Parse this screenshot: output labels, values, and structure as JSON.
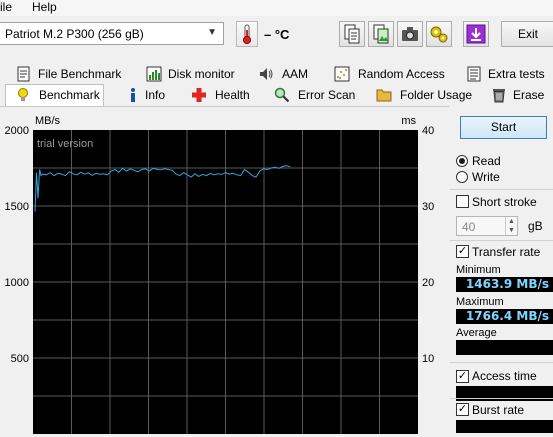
{
  "menu": [
    "ile",
    "Help"
  ],
  "toolbar": {
    "drive": "Patriot M.2 P300 (256 gB)",
    "temperature": "– °C",
    "exit_label": "Exit"
  },
  "tabs_row1": [
    {
      "label": "File Benchmark",
      "icon": "file-benchmark-icon"
    },
    {
      "label": "Disk monitor",
      "icon": "disk-monitor-icon"
    },
    {
      "label": "AAM",
      "icon": "speaker-icon"
    },
    {
      "label": "Random Access",
      "icon": "random-access-icon"
    },
    {
      "label": "Extra tests",
      "icon": "extra-tests-icon"
    }
  ],
  "tabs_row2": [
    {
      "label": "Benchmark",
      "icon": "lightbulb-icon",
      "active": true
    },
    {
      "label": "Info",
      "icon": "info-icon"
    },
    {
      "label": "Health",
      "icon": "health-cross-icon"
    },
    {
      "label": "Error Scan",
      "icon": "magnifier-icon"
    },
    {
      "label": "Folder Usage",
      "icon": "folder-icon"
    },
    {
      "label": "Erase",
      "icon": "trash-icon"
    }
  ],
  "panel": {
    "start_label": "Start",
    "read_label": "Read",
    "write_label": "Write",
    "mode": "read",
    "short_stroke_label": "Short stroke",
    "short_stroke_checked": false,
    "stroke_value": "40",
    "stroke_unit": "gB",
    "transfer_rate_label": "Transfer rate",
    "transfer_rate_checked": true,
    "minimum_label": "Minimum",
    "minimum_value": "1463.9 MB/s",
    "maximum_label": "Maximum",
    "maximum_value": "1766.4 MB/s",
    "average_label": "Average",
    "average_value": "",
    "access_time_label": "Access time",
    "access_time_checked": true,
    "burst_rate_label": "Burst rate",
    "burst_rate_checked": true,
    "burst_rate_value": ""
  },
  "chart_data": {
    "type": "line",
    "watermark": "trial version",
    "ylabel": "MB/s",
    "y2label": "ms",
    "ylim": [
      0,
      2000
    ],
    "y2lim": [
      0,
      40
    ],
    "yticks": [
      "2000",
      "1500",
      "1000",
      "500"
    ],
    "y2ticks": [
      "40",
      "30",
      "20",
      "10"
    ],
    "xlim": [
      0,
      100
    ],
    "grid": true,
    "line_color": "#36a3d9",
    "series": [
      {
        "x": [
          0,
          0.4,
          0.8,
          1.2,
          1.6,
          2,
          3,
          4,
          5,
          6,
          7,
          8,
          9,
          10,
          11,
          12,
          13,
          14,
          15,
          16,
          17,
          18,
          19,
          20,
          21,
          22,
          23,
          24,
          25,
          26,
          27,
          28,
          29,
          30,
          31,
          32,
          33,
          34,
          35,
          36,
          37,
          38,
          39,
          40,
          41,
          42,
          43,
          44,
          45,
          46,
          47,
          48,
          49,
          50,
          51,
          52,
          53,
          54,
          55,
          56,
          57,
          58,
          59,
          60,
          61,
          62,
          63,
          64,
          65,
          66,
          67
        ],
        "y": [
          1464,
          1720,
          1550,
          1740,
          1700,
          1710,
          1705,
          1720,
          1700,
          1715,
          1710,
          1700,
          1725,
          1712,
          1705,
          1722,
          1710,
          1718,
          1702,
          1715,
          1708,
          1712,
          1705,
          1730,
          1740,
          1722,
          1748,
          1730,
          1745,
          1735,
          1725,
          1740,
          1745,
          1730,
          1748,
          1742,
          1738,
          1745,
          1740,
          1735,
          1710,
          1700,
          1720,
          1705,
          1690,
          1712,
          1695,
          1708,
          1700,
          1715,
          1705,
          1712,
          1708,
          1720,
          1710,
          1715,
          1705,
          1700,
          1740,
          1722,
          1700,
          1690,
          1730,
          1745,
          1740,
          1750,
          1755,
          1748,
          1760,
          1766,
          1758
        ]
      }
    ]
  }
}
